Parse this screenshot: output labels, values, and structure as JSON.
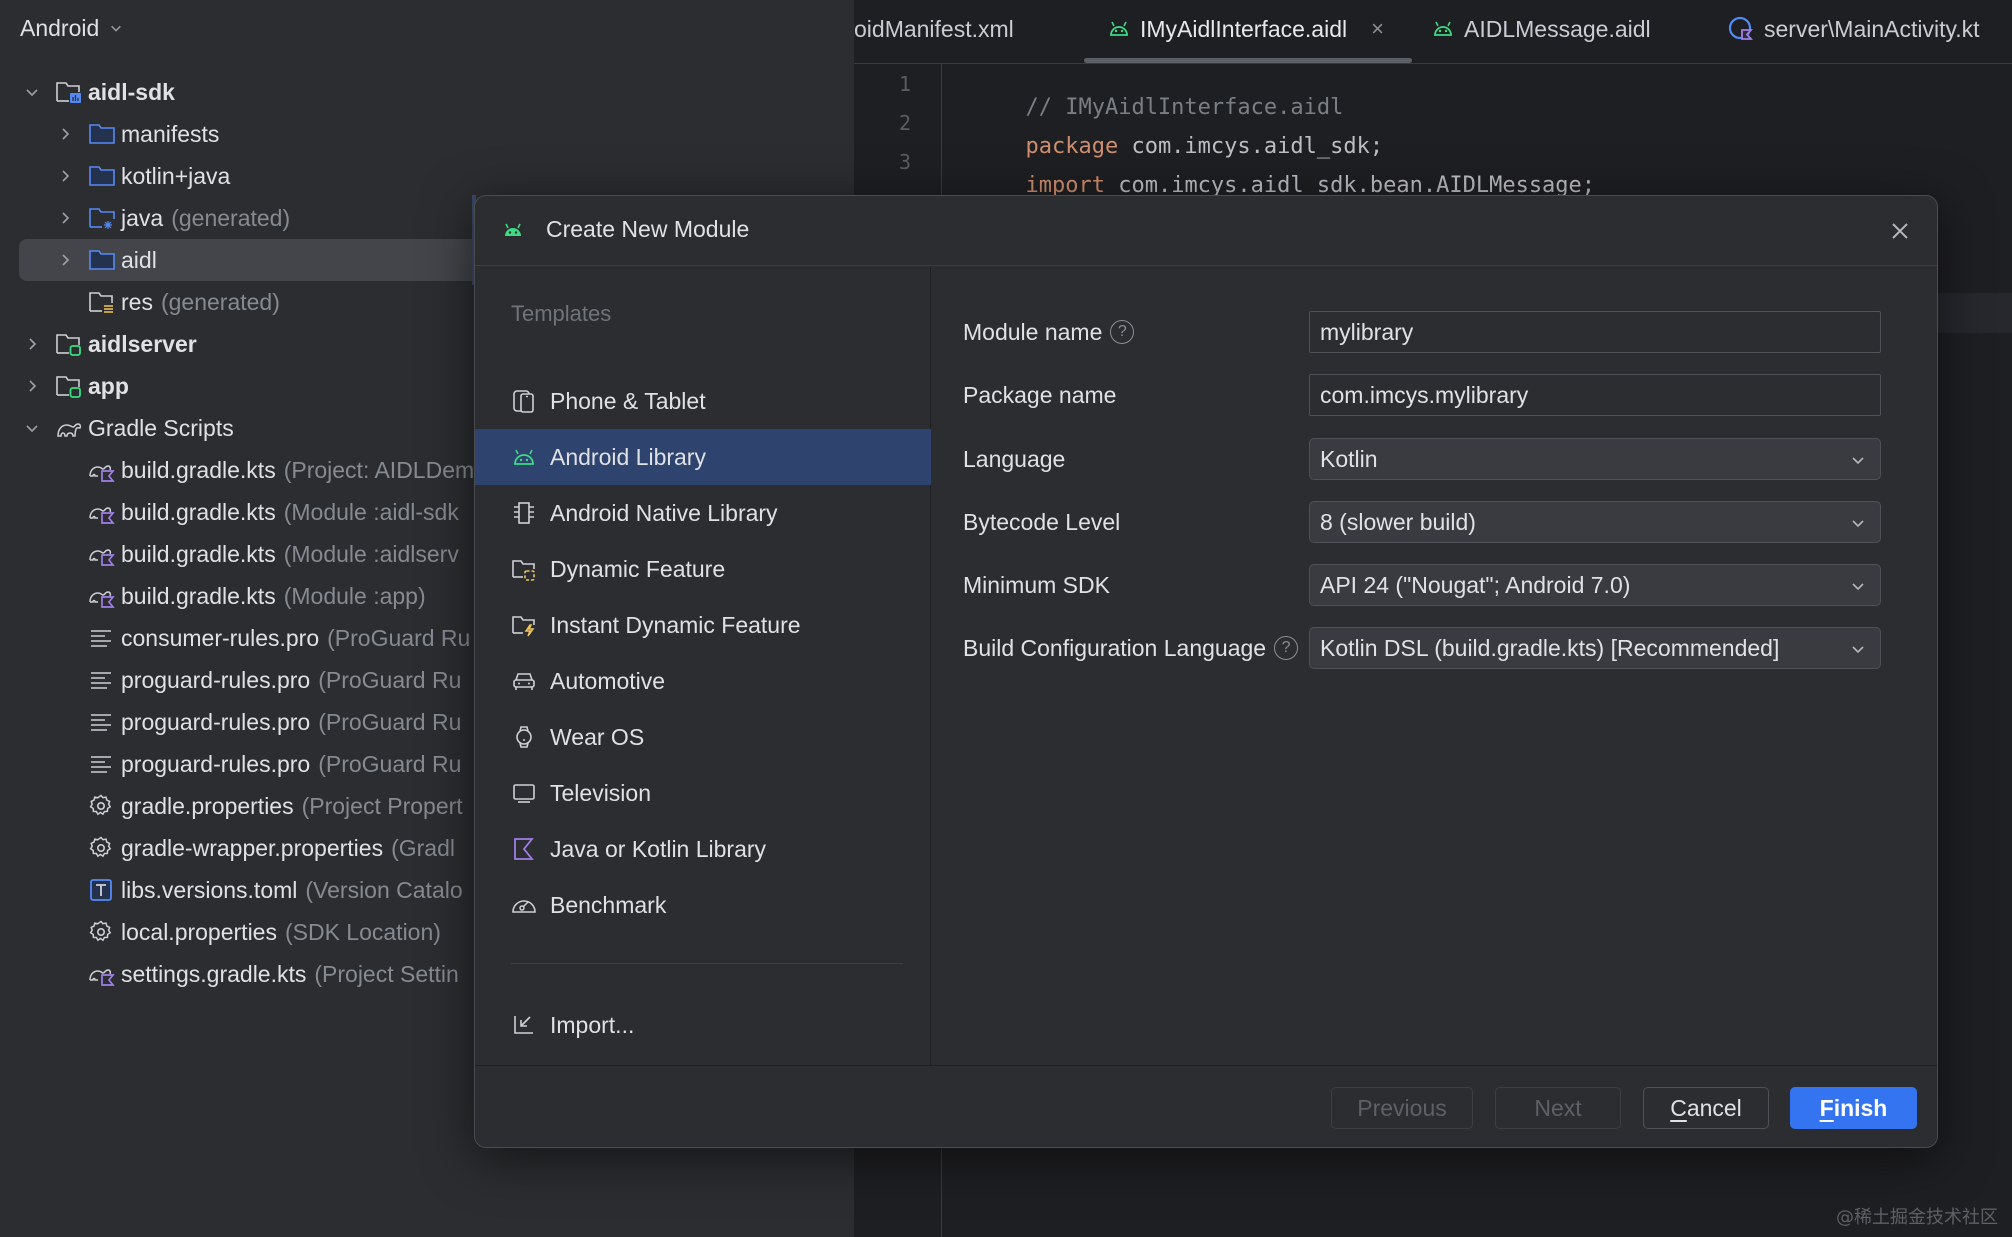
{
  "project_panel": {
    "view_selector": "Android",
    "tree": [
      {
        "label": "aidl-sdk",
        "hint": "",
        "icon": "module-folder-icon",
        "expanded": true,
        "level": 0
      },
      {
        "label": "manifests",
        "hint": "",
        "icon": "folder-icon",
        "expanded": false,
        "level": 1
      },
      {
        "label": "kotlin+java",
        "hint": "",
        "icon": "folder-icon",
        "expanded": false,
        "level": 1
      },
      {
        "label": "java",
        "hint": "(generated)",
        "icon": "generated-source-folder-icon",
        "expanded": false,
        "level": 1
      },
      {
        "label": "aidl",
        "hint": "",
        "icon": "folder-icon",
        "expanded": false,
        "level": 1,
        "selected": true
      },
      {
        "label": "res",
        "hint": "(generated)",
        "icon": "resource-folder-icon",
        "level": 1
      },
      {
        "label": "aidlserver",
        "hint": "",
        "icon": "app-module-icon",
        "expanded": false,
        "level": 0
      },
      {
        "label": "app",
        "hint": "",
        "icon": "app-module-icon",
        "expanded": false,
        "level": 0
      },
      {
        "label": "Gradle Scripts",
        "hint": "",
        "icon": "gradle-icon",
        "expanded": true,
        "level": 0
      },
      {
        "label": "build.gradle.kts",
        "hint": "(Project: AIDLDem",
        "icon": "gradle-kts-icon",
        "level": 1
      },
      {
        "label": "build.gradle.kts",
        "hint": "(Module :aidl-sdk",
        "icon": "gradle-kts-icon",
        "level": 1
      },
      {
        "label": "build.gradle.kts",
        "hint": "(Module :aidlserv",
        "icon": "gradle-kts-icon",
        "level": 1
      },
      {
        "label": "build.gradle.kts",
        "hint": "(Module :app)",
        "icon": "gradle-kts-icon",
        "level": 1
      },
      {
        "label": "consumer-rules.pro",
        "hint": "(ProGuard Ru",
        "icon": "text-file-icon",
        "level": 1
      },
      {
        "label": "proguard-rules.pro",
        "hint": "(ProGuard Ru",
        "icon": "text-file-icon",
        "level": 1
      },
      {
        "label": "proguard-rules.pro",
        "hint": "(ProGuard Ru",
        "icon": "text-file-icon",
        "level": 1
      },
      {
        "label": "proguard-rules.pro",
        "hint": "(ProGuard Ru",
        "icon": "text-file-icon",
        "level": 1
      },
      {
        "label": "gradle.properties",
        "hint": "(Project Propert",
        "icon": "settings-file-icon",
        "level": 1
      },
      {
        "label": "gradle-wrapper.properties",
        "hint": "(Gradl",
        "icon": "settings-file-icon",
        "level": 1
      },
      {
        "label": "libs.versions.toml",
        "hint": "(Version Catalo",
        "icon": "toml-file-icon",
        "level": 1
      },
      {
        "label": "local.properties",
        "hint": "(SDK Location)",
        "icon": "settings-file-icon",
        "level": 1
      },
      {
        "label": "settings.gradle.kts",
        "hint": "(Project Settin",
        "icon": "gradle-kts-icon",
        "level": 1
      }
    ]
  },
  "editor": {
    "tabs": [
      {
        "label": "oidManifest.xml",
        "icon": "",
        "active": false
      },
      {
        "label": "IMyAidlInterface.aidl",
        "icon": "android-icon",
        "active": true,
        "closable": true
      },
      {
        "label": "AIDLMessage.aidl",
        "icon": "android-icon",
        "active": false
      },
      {
        "label": "server\\MainActivity.kt",
        "icon": "kotlin-class-icon",
        "active": false
      }
    ],
    "close_glyph": "×",
    "lines": [
      {
        "number": "1",
        "parts": [
          {
            "text": "// IMyAidlInterface.aidl",
            "kind": "comment"
          }
        ]
      },
      {
        "number": "2",
        "parts": [
          {
            "text": "package",
            "kind": "keyword"
          },
          {
            "text": " com.imcys.aidl_sdk;",
            "kind": "plain"
          }
        ]
      },
      {
        "number": "3",
        "parts": [
          {
            "text": "import",
            "kind": "keyword"
          },
          {
            "text": " com.imcys.aidl_sdk.bean.AIDLMessage;",
            "kind": "plain"
          }
        ]
      }
    ]
  },
  "dialog": {
    "title": "Create New Module",
    "templates_heading": "Templates",
    "templates": [
      {
        "label": "Phone & Tablet",
        "icon": "phone-tablet-icon"
      },
      {
        "label": "Android Library",
        "icon": "android-icon",
        "selected": true
      },
      {
        "label": "Android Native Library",
        "icon": "native-library-icon"
      },
      {
        "label": "Dynamic Feature",
        "icon": "dynamic-feature-icon"
      },
      {
        "label": "Instant Dynamic Feature",
        "icon": "instant-feature-icon"
      },
      {
        "label": "Automotive",
        "icon": "car-icon"
      },
      {
        "label": "Wear OS",
        "icon": "watch-icon"
      },
      {
        "label": "Television",
        "icon": "tv-icon"
      },
      {
        "label": "Java or Kotlin Library",
        "icon": "kotlin-icon"
      },
      {
        "label": "Benchmark",
        "icon": "gauge-icon"
      }
    ],
    "import_label": "Import...",
    "form": {
      "module_name": {
        "label": "Module name",
        "value": "mylibrary",
        "help": "?"
      },
      "package_name": {
        "label": "Package name",
        "value": "com.imcys.mylibrary"
      },
      "language": {
        "label": "Language",
        "value": "Kotlin"
      },
      "bytecode_level": {
        "label": "Bytecode Level",
        "value": "8 (slower build)"
      },
      "minimum_sdk": {
        "label": "Minimum SDK",
        "value": "API 24 (\"Nougat\"; Android 7.0)"
      },
      "build_config_language": {
        "label": "Build Configuration Language",
        "value": "Kotlin DSL (build.gradle.kts) [Recommended]",
        "help": "?"
      }
    },
    "buttons": {
      "previous": "Previous",
      "next": "Next",
      "cancel_mnemonic": "C",
      "cancel_rest": "ancel",
      "finish_mnemonic": "F",
      "finish_rest": "inish"
    }
  },
  "colors": {
    "accent": "#3574f0",
    "selection": "#2e436e",
    "android_green": "#3ddc84",
    "kotlin_purple": "#a17ee8",
    "folder_blue": "#548af7"
  },
  "watermark": "@稀土掘金技术社区"
}
